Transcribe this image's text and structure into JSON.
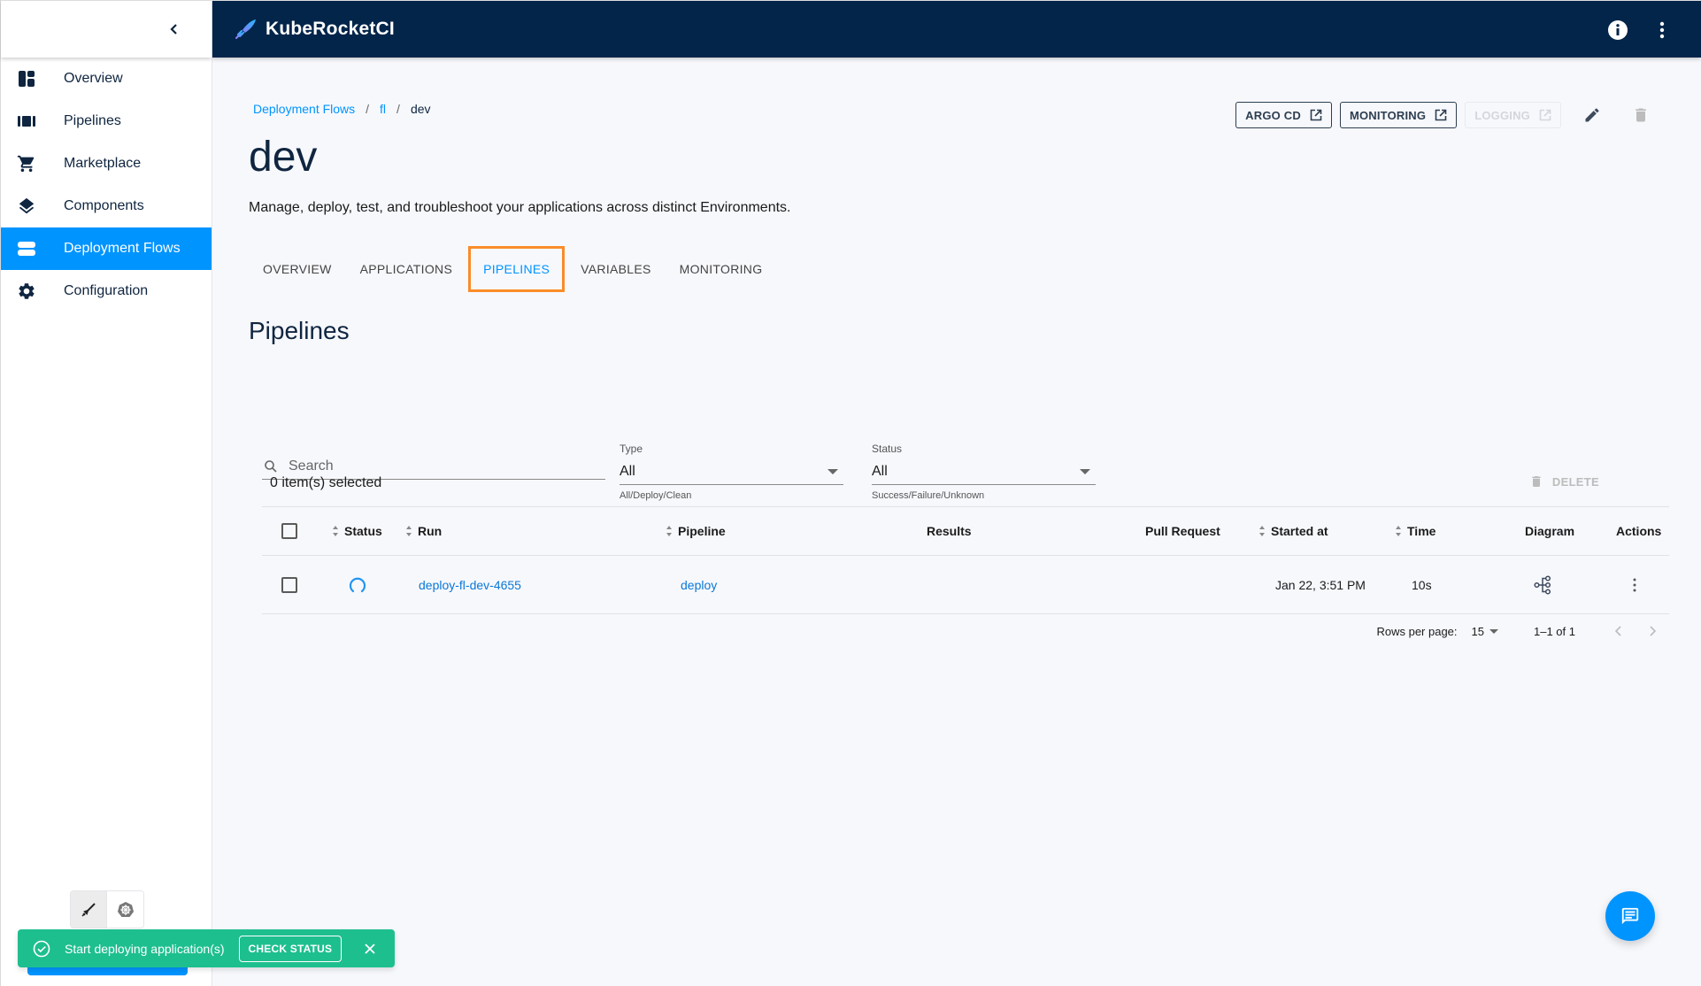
{
  "app": {
    "brand": "KubeRocketCI"
  },
  "sidebar": {
    "items": [
      {
        "label": "Overview",
        "icon": "dashboard-icon",
        "active": false
      },
      {
        "label": "Pipelines",
        "icon": "pipelines-icon",
        "active": false
      },
      {
        "label": "Marketplace",
        "icon": "cart-icon",
        "active": false
      },
      {
        "label": "Components",
        "icon": "layers-icon",
        "active": false
      },
      {
        "label": "Deployment Flows",
        "icon": "deployment-flows-icon",
        "active": true
      },
      {
        "label": "Configuration",
        "icon": "gear-icon",
        "active": false
      }
    ]
  },
  "breadcrumb": {
    "items": [
      {
        "label": "Deployment Flows",
        "link": true
      },
      {
        "label": "fl",
        "link": true
      },
      {
        "label": "dev",
        "link": false
      }
    ],
    "separator": "/"
  },
  "page": {
    "title": "dev",
    "description": "Manage, deploy, test, and troubleshoot your applications across distinct Environments."
  },
  "header_actions": {
    "argo_cd": "ARGO CD",
    "monitoring": "MONITORING",
    "logging": "LOGGING"
  },
  "tabs": [
    {
      "label": "OVERVIEW",
      "active": false
    },
    {
      "label": "APPLICATIONS",
      "active": false
    },
    {
      "label": "PIPELINES",
      "active": true
    },
    {
      "label": "VARIABLES",
      "active": false
    },
    {
      "label": "MONITORING",
      "active": false
    }
  ],
  "section": {
    "title": "Pipelines"
  },
  "filters": {
    "search": {
      "placeholder": "Search",
      "value": ""
    },
    "type": {
      "label": "Type",
      "value": "All",
      "helper": "All/Deploy/Clean"
    },
    "status": {
      "label": "Status",
      "value": "All",
      "helper": "Success/Failure/Unknown"
    }
  },
  "selection": {
    "count_text": "0 item(s) selected",
    "delete_label": "DELETE"
  },
  "table": {
    "columns": [
      "Status",
      "Run",
      "Pipeline",
      "Results",
      "Pull Request",
      "Started at",
      "Time",
      "Diagram",
      "Actions"
    ],
    "rows": [
      {
        "status": "running",
        "run": "deploy-fl-dev-4655",
        "pipeline": "deploy",
        "results": "",
        "pull_request": "",
        "started_at": "Jan 22, 3:51 PM",
        "time": "10s"
      }
    ]
  },
  "pagination": {
    "rows_per_page_label": "Rows per page:",
    "rows_per_page": "15",
    "range": "1–1 of 1"
  },
  "toast": {
    "message": "Start deploying application(s)",
    "action": "CHECK STATUS"
  },
  "colors": {
    "primary": "#0094ff",
    "topbar": "#03254a",
    "toast": "#1ebf8f",
    "highlight": "#fa8c28"
  }
}
